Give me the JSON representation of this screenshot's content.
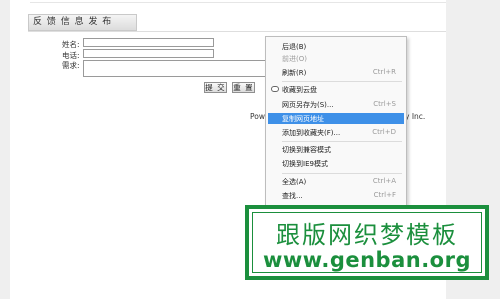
{
  "form": {
    "title": "反 馈 信 息 发 布",
    "name_label": "姓名:",
    "phone_label": "电话:",
    "request_label": "需求:",
    "submit_label": "提 交",
    "reset_label": "重 置",
    "footer_left": "Pow",
    "footer_right": "y Inc."
  },
  "context_menu": {
    "items": [
      {
        "label": "后退(B)",
        "shortcut": ""
      },
      {
        "label": "前进(O)",
        "shortcut": ""
      },
      {
        "label": "刷新(R)",
        "shortcut": "Ctrl+R"
      },
      {
        "label": "收藏到云盘",
        "shortcut": ""
      },
      {
        "label": "网页另存为(S)...",
        "shortcut": "Ctrl+S"
      },
      {
        "label": "复制网页地址",
        "shortcut": ""
      },
      {
        "label": "添加到收藏夹(F)...",
        "shortcut": "Ctrl+D"
      },
      {
        "label": "切换到兼容模式",
        "shortcut": ""
      },
      {
        "label": "切换到IE9模式",
        "shortcut": ""
      },
      {
        "label": "全选(A)",
        "shortcut": "Ctrl+A"
      },
      {
        "label": "查找...",
        "shortcut": "Ctrl+F"
      }
    ]
  },
  "watermark": {
    "title": "跟版网织梦模板",
    "url": "www.genban.org"
  },
  "colors": {
    "highlight": "#3e90e8",
    "watermark_green": "#1b8f3d"
  }
}
